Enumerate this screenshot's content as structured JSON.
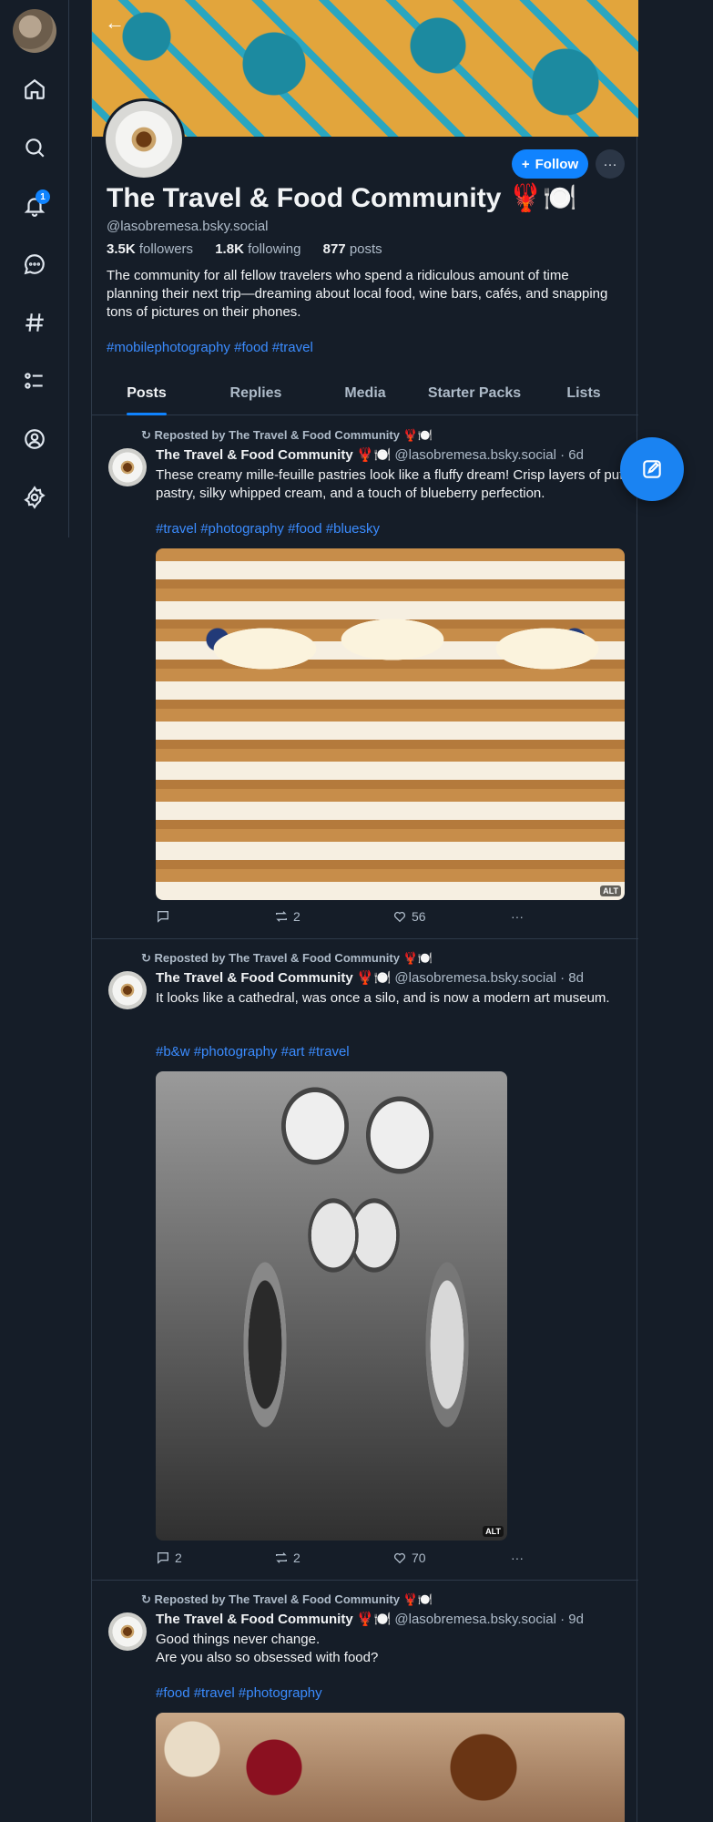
{
  "sidebar": {
    "badge_count": "1"
  },
  "profile": {
    "display_name": "The Travel & Food Community 🦞🍽️",
    "handle": "@lasobremesa.bsky.social",
    "followers_count": "3.5K",
    "followers_label": "followers",
    "following_count": "1.8K",
    "following_label": "following",
    "posts_count": "877",
    "posts_label": "posts",
    "bio": "The community for all fellow travelers who spend a ridiculous amount of time planning their next trip—dreaming about local food, wine bars, cafés, and snapping tons of pictures on their phones.",
    "bio_tags": "#mobilephotography #food #travel",
    "follow_label": "Follow",
    "more_label": "···"
  },
  "tabs": [
    "Posts",
    "Replies",
    "Media",
    "Starter Packs",
    "Lists"
  ],
  "posts": [
    {
      "repost_label": "Reposted by The Travel & Food Community 🦞🍽️",
      "author": "The Travel & Food Community 🦞🍽️",
      "handle_time": "@lasobremesa.bsky.social · 6d",
      "text": "These creamy mille-feuille pastries look like a fluffy dream! Crisp layers of puff pastry, silky whipped cream, and a touch of blueberry perfection.",
      "tags": "#travel #photography #food #bluesky",
      "alt": "ALT",
      "replies": "",
      "reposts": "2",
      "likes": "56"
    },
    {
      "repost_label": "Reposted by The Travel & Food Community 🦞🍽️",
      "author": "The Travel & Food Community 🦞🍽️",
      "handle_time": "@lasobremesa.bsky.social · 8d",
      "text": "It looks like a cathedral, was once a silo, and is now a modern art museum.",
      "tags": "#b&w #photography #art #travel",
      "alt": "ALT",
      "replies": "2",
      "reposts": "2",
      "likes": "70"
    },
    {
      "repost_label": "Reposted by The Travel & Food Community 🦞🍽️",
      "author": "The Travel & Food Community 🦞🍽️",
      "handle_time": "@lasobremesa.bsky.social · 9d",
      "text": "Good things never change.\nAre you also so obsessed with food?",
      "tags": "#food #travel #photography"
    }
  ]
}
